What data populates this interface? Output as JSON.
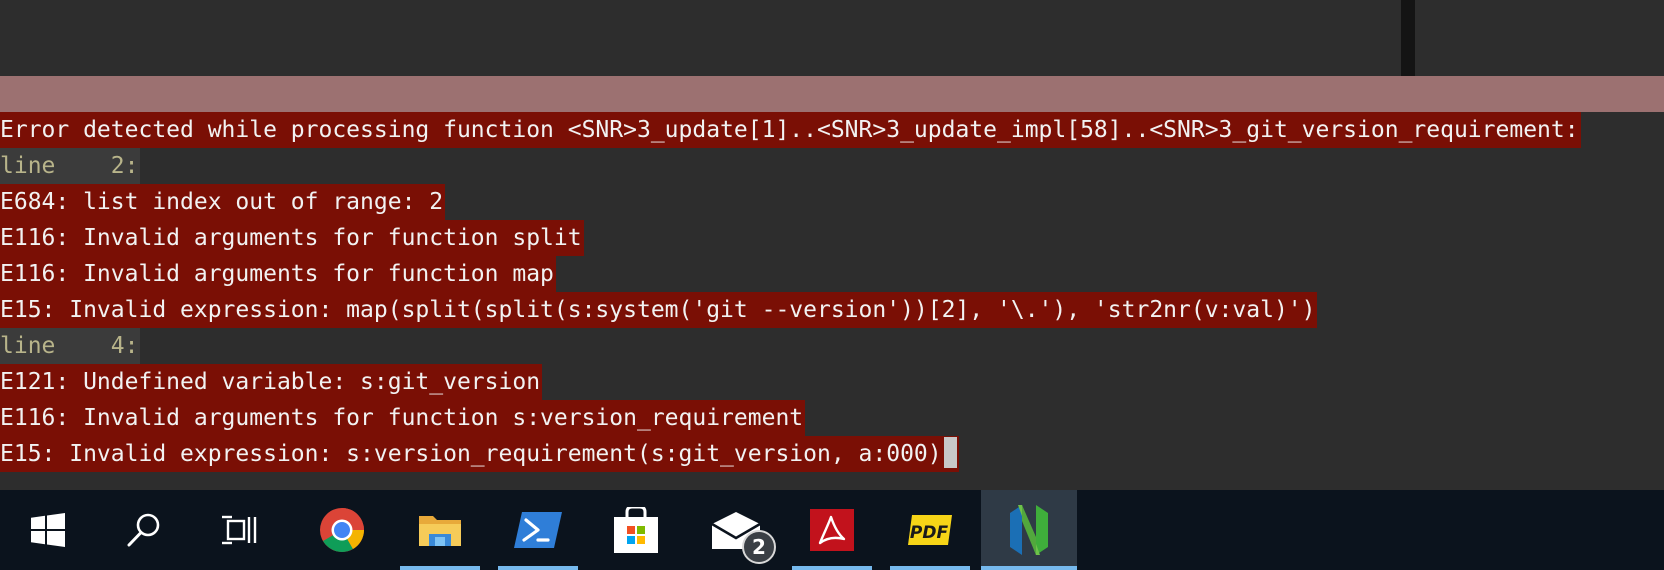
{
  "editor": {
    "message_lines": [
      {
        "text": "Error detected while processing function <SNR>3_update[1]..<SNR>3_update_impl[58]..<SNR>3_git_version_requirement:",
        "kind": "error"
      },
      {
        "text": "line    2:",
        "kind": "lineno"
      },
      {
        "text": "E684: list index out of range: 2",
        "kind": "error"
      },
      {
        "text": "E116: Invalid arguments for function split",
        "kind": "error"
      },
      {
        "text": "E116: Invalid arguments for function map",
        "kind": "error"
      },
      {
        "text": "E15: Invalid expression: map(split(split(s:system('git --version'))[2], '\\.'), 'str2nr(v:val)')",
        "kind": "error"
      },
      {
        "text": "line    4:",
        "kind": "lineno"
      },
      {
        "text": "E121: Undefined variable: s:git_version",
        "kind": "error"
      },
      {
        "text": "E116: Invalid arguments for function s:version_requirement",
        "kind": "error"
      },
      {
        "text": "E15: Invalid expression: s:version_requirement(s:git_version, a:000)",
        "kind": "error"
      }
    ]
  },
  "colors": {
    "editor_bg": "#2d2d2d",
    "status_bar": "#9c7171",
    "error_bg": "#7a0f05",
    "error_text": "#f2f2f2",
    "lineno_text": "#b8b48a",
    "cursor": "#c8c8c8",
    "taskbar_bg": "#0b131d",
    "running_indicator": "#76b9ed"
  },
  "taskbar": {
    "items": [
      {
        "name": "start-button",
        "icon": "windows-logo-icon"
      },
      {
        "name": "search-button",
        "icon": "search-icon"
      },
      {
        "name": "task-view-button",
        "icon": "task-view-icon"
      },
      {
        "name": "chrome-app",
        "icon": "chrome-icon"
      },
      {
        "name": "file-explorer-app",
        "icon": "folder-icon",
        "running": true
      },
      {
        "name": "powershell-app",
        "icon": "powershell-icon",
        "running": true
      },
      {
        "name": "microsoft-store-app",
        "icon": "store-bag-icon"
      },
      {
        "name": "mail-app",
        "icon": "mail-icon",
        "badge": "2"
      },
      {
        "name": "acrobat-app",
        "icon": "acrobat-icon",
        "running": true
      },
      {
        "name": "pdf-app",
        "icon": "pdf-icon",
        "running": true
      },
      {
        "name": "neovim-app",
        "icon": "neovim-icon",
        "running": true,
        "active": true
      }
    ]
  }
}
